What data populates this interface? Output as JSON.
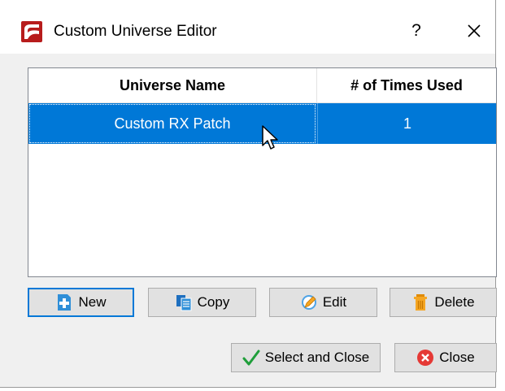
{
  "window": {
    "title": "Custom Universe Editor",
    "help_label": "?",
    "icons": {
      "app": "app-logo-icon",
      "close": "close-icon"
    }
  },
  "table": {
    "columns": [
      "Universe Name",
      "# of Times Used"
    ],
    "rows": [
      {
        "name": "Custom RX Patch",
        "times_used": "1",
        "selected": true
      }
    ],
    "selection_color": "#0078d7"
  },
  "buttons": {
    "new": "New",
    "copy": "Copy",
    "edit": "Edit",
    "delete": "Delete",
    "select_and_close": "Select and Close",
    "close": "Close"
  },
  "colors": {
    "accent": "#0078d7",
    "brand": "#b71c1c"
  }
}
